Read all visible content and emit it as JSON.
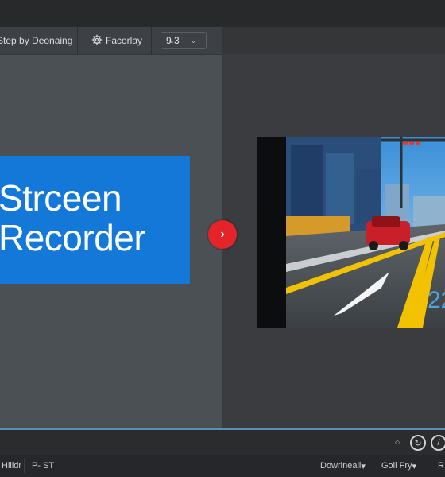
{
  "toolbar": {
    "step_label": "Step by Deonaing",
    "favorites_label": "Facorlay",
    "select_value": "9̵ 3"
  },
  "brand": {
    "line1": "Strceen",
    "line2": "Recorder",
    "color": "#1478d8"
  },
  "preview": {
    "overlay_number": "22"
  },
  "statusbar": {
    "left_label": "Hilldr",
    "mode_label": "P- ST",
    "download_label": "Dowrlneall",
    "quality_label": "Goll Fry",
    "right_label": "R"
  },
  "icons": {
    "favorites": "settings-gear-icon",
    "next": "chevron-right-icon",
    "refresh": "refresh-icon",
    "stop": "stop-icon"
  },
  "accent_colors": {
    "next_button": "#e5242a",
    "timeline": "#5b8fb5"
  }
}
